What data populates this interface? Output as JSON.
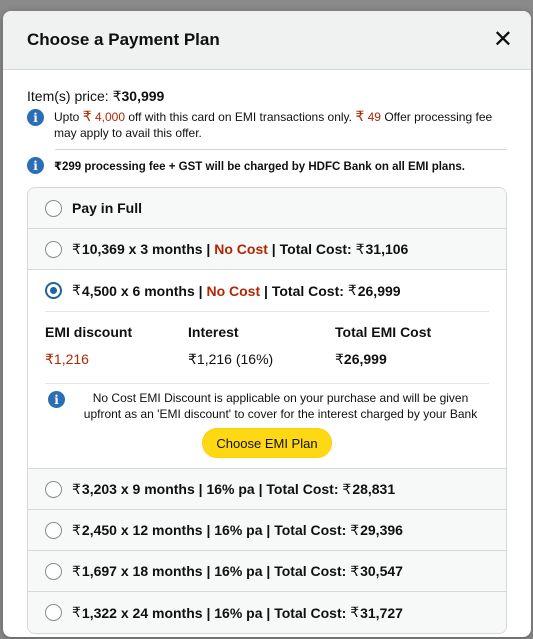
{
  "backdrop": {
    "partial_text": "...g y y..."
  },
  "modal": {
    "title": "Choose a Payment Plan",
    "close_icon": "close-icon"
  },
  "price": {
    "label": "Item(s) price:",
    "currency": "₹",
    "amount": "30,999"
  },
  "offer": {
    "prefix": "Upto",
    "discount_currency": "₹",
    "discount_amount": "4,000",
    "middle": "off with this card on EMI transactions only.",
    "fee_currency": "₹",
    "fee_amount": "49",
    "suffix": "Offer processing fee may apply to avail this offer."
  },
  "fee_notice": "₹299 processing fee + GST will be charged by HDFC Bank on all EMI plans.",
  "plans": [
    {
      "id": "full",
      "label": "Pay in Full",
      "checked": false
    },
    {
      "id": "3m",
      "currency": "₹",
      "amount": "10,369",
      "tenure": "x 3 months",
      "rate": "No Cost",
      "rate_red": true,
      "total_label": "Total Cost:",
      "total_currency": "₹",
      "total": "31,106",
      "checked": false
    },
    {
      "id": "6m",
      "currency": "₹",
      "amount": "4,500",
      "tenure": "x 6 months",
      "rate": "No Cost",
      "rate_red": true,
      "total_label": "Total Cost:",
      "total_currency": "₹",
      "total": "26,999",
      "checked": true
    },
    {
      "id": "9m",
      "currency": "₹",
      "amount": "3,203",
      "tenure": "x 9 months",
      "rate": "16% pa",
      "rate_red": false,
      "total_label": "Total Cost:",
      "total_currency": "₹",
      "total": "28,831",
      "checked": false
    },
    {
      "id": "12m",
      "currency": "₹",
      "amount": "2,450",
      "tenure": "x 12 months",
      "rate": "16% pa",
      "rate_red": false,
      "total_label": "Total Cost:",
      "total_currency": "₹",
      "total": "29,396",
      "checked": false
    },
    {
      "id": "18m",
      "currency": "₹",
      "amount": "1,697",
      "tenure": "x 18 months",
      "rate": "16% pa",
      "rate_red": false,
      "total_label": "Total Cost:",
      "total_currency": "₹",
      "total": "30,547",
      "checked": false
    },
    {
      "id": "24m",
      "currency": "₹",
      "amount": "1,322",
      "tenure": "x 24 months",
      "rate": "16% pa",
      "rate_red": false,
      "total_label": "Total Cost:",
      "total_currency": "₹",
      "total": "31,727",
      "checked": false
    }
  ],
  "selected_details": {
    "emi_discount_label": "EMI discount",
    "emi_discount_currency": "₹",
    "emi_discount_value": "1,216",
    "interest_label": "Interest",
    "interest_value": "₹1,216 (16%)",
    "total_emi_label": "Total EMI Cost",
    "total_emi_currency": "₹",
    "total_emi_value": "26,999",
    "note": "No Cost EMI Discount is applicable on your purchase and will be given upfront as an 'EMI discount' to cover for the interest charged by your Bank",
    "button_label": "Choose EMI Plan"
  },
  "colors": {
    "accent_red": "#b12704",
    "button_yellow": "#ffd814",
    "info_blue": "#2a6fb5",
    "radio_blue": "#2162a1"
  }
}
